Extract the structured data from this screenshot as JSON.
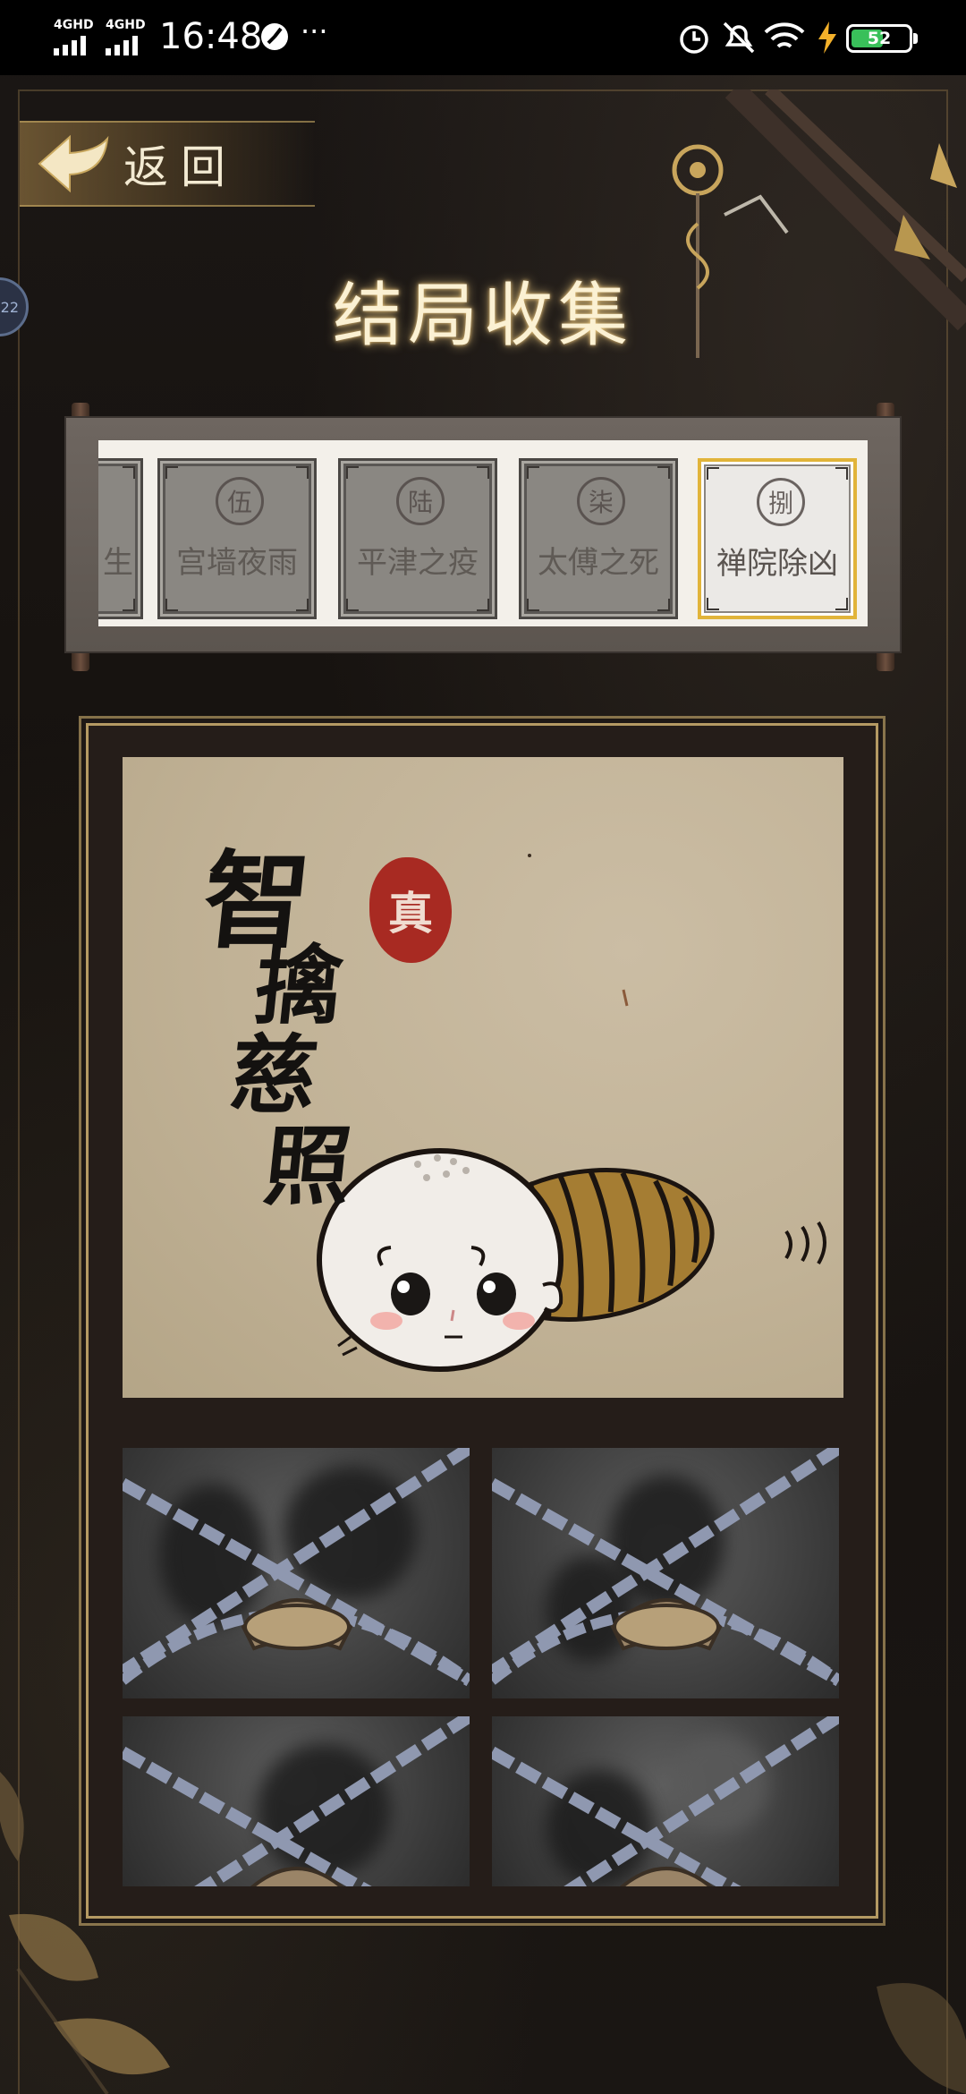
{
  "status_bar": {
    "network_1": "4GHD",
    "network_2": "4GHD",
    "time": "16:48",
    "more": "···",
    "battery": "52"
  },
  "header": {
    "back_label": "返回",
    "title": "结局收集",
    "side_badge": "22"
  },
  "endings": [
    {
      "seal": "",
      "name": "生",
      "selected": false
    },
    {
      "seal": "伍",
      "name": "宫墙夜雨",
      "selected": false
    },
    {
      "seal": "陆",
      "name": "平津之疫",
      "selected": false
    },
    {
      "seal": "柒",
      "name": "太傅之死",
      "selected": false
    },
    {
      "seal": "捌",
      "name": "禅院除凶",
      "selected": true
    }
  ],
  "featured": {
    "calligraphy": [
      "智",
      "擒",
      "慈",
      "照"
    ],
    "stamp": "真"
  },
  "locked_slots": [
    {
      "state": "locked"
    },
    {
      "state": "locked"
    },
    {
      "state": "locked"
    },
    {
      "state": "locked"
    }
  ],
  "colors": {
    "gold_frame": "#b59a63",
    "selected_border": "#e1b43a",
    "stamp_red": "#a82a22",
    "battery_green": "#39c05a"
  }
}
